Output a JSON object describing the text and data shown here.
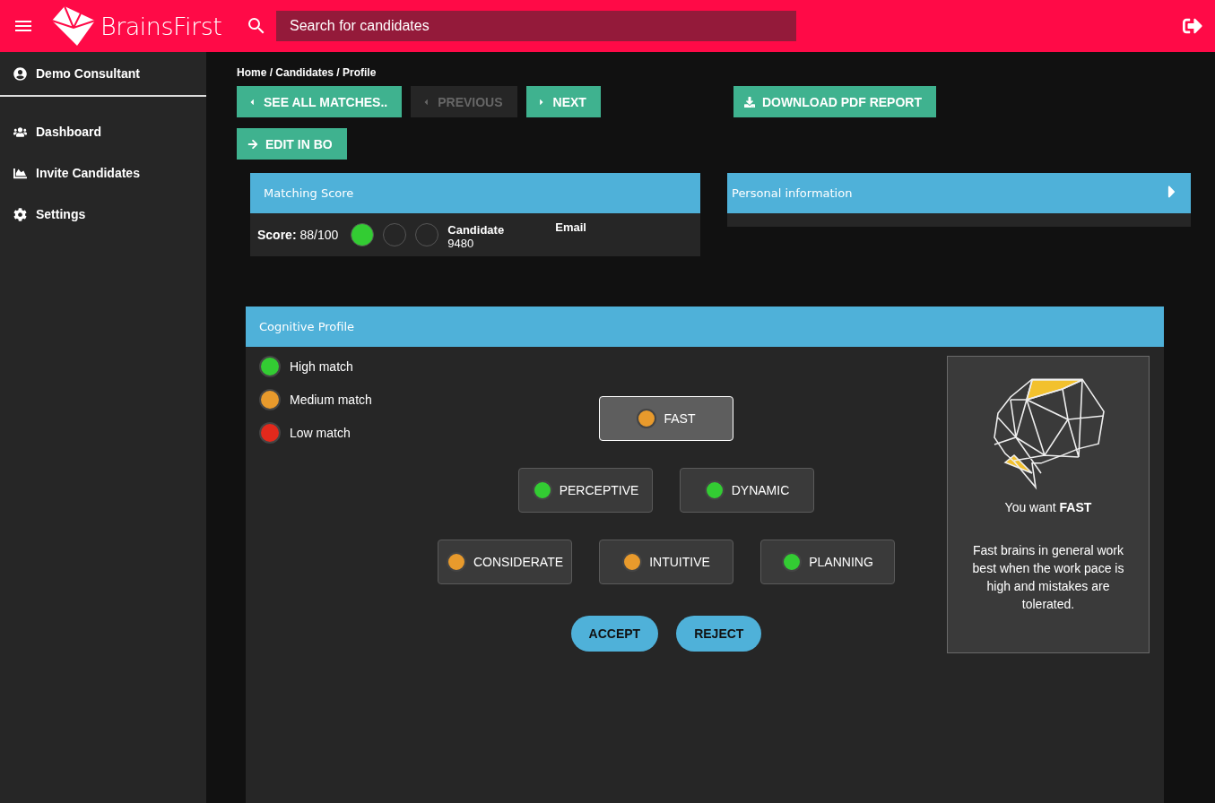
{
  "topbar": {
    "logo_text": "BrainsFirst",
    "search": {
      "placeholder": "Search for candidates"
    }
  },
  "sidebar": {
    "user": "Demo Consultant",
    "items": [
      {
        "label": "Dashboard"
      },
      {
        "label": "Invite Candidates"
      },
      {
        "label": "Settings"
      }
    ]
  },
  "breadcrumb": "Home / Candidates / Profile",
  "actions": [
    {
      "label": "SEE ALL MATCHES..",
      "disabled": false
    },
    {
      "label": "PREVIOUS",
      "disabled": true
    },
    {
      "label": "NEXT",
      "disabled": false
    },
    {
      "label": "DOWNLOAD PDF REPORT",
      "disabled": false
    }
  ],
  "edit_button": {
    "label": "EDIT IN BO"
  },
  "matching_score": {
    "title": "Matching Score",
    "score_label": "Score:",
    "score": "88/100",
    "dots": [
      {
        "lit": true
      },
      {
        "lit": false
      },
      {
        "lit": false
      }
    ],
    "candidate_label": "Candidate",
    "candidate_value": "9480",
    "email_label": "Email"
  },
  "personal_information": {
    "title": "Personal information",
    "expanded": false
  },
  "cognitive_profile": {
    "title": "Cognitive Profile",
    "legend": [
      {
        "label": "High match",
        "color": "#33cc33"
      },
      {
        "label": "Medium match",
        "color": "#e89a2c"
      },
      {
        "label": "Low match",
        "color": "#e2291c"
      }
    ],
    "trait_rows": [
      [
        {
          "label": "FAST",
          "color": "#e89a2c",
          "selected": true
        }
      ],
      [
        {
          "label": "PERCEPTIVE",
          "color": "#33cc33",
          "selected": false
        },
        {
          "label": "DYNAMIC",
          "color": "#33cc33",
          "selected": false
        }
      ],
      [
        {
          "label": "CONSIDERATE",
          "color": "#e89a2c",
          "selected": false
        },
        {
          "label": "INTUITIVE",
          "color": "#e89a2c",
          "selected": false
        },
        {
          "label": "PLANNING",
          "color": "#33cc33",
          "selected": false
        }
      ]
    ],
    "buttons": [
      "ACCEPT",
      "REJECT"
    ],
    "card": {
      "heading": "You want **FAST**",
      "text": "Fast brains in general work best when the work pace is high and mistakes are tolerated."
    }
  }
}
